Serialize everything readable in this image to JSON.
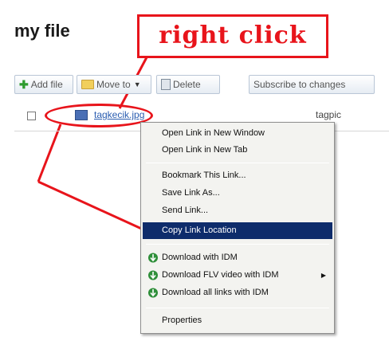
{
  "page": {
    "title": "my file"
  },
  "annotation": {
    "text": "right click",
    "color": "#e8141b"
  },
  "toolbar": {
    "add_label": "Add file",
    "move_label": "Move to",
    "delete_label": "Delete",
    "subscribe_label": "Subscribe to changes"
  },
  "file_row": {
    "name": "tagkecik.jpg",
    "tag": "tagpic"
  },
  "menu": {
    "items": [
      "Open Link in New Window",
      "Open Link in New Tab",
      "Bookmark This Link...",
      "Save Link As...",
      "Send Link...",
      "Copy Link Location",
      "Download with IDM",
      "Download FLV video with IDM",
      "Download all links with IDM",
      "Properties"
    ],
    "highlight_color": "#0e2c6b"
  }
}
